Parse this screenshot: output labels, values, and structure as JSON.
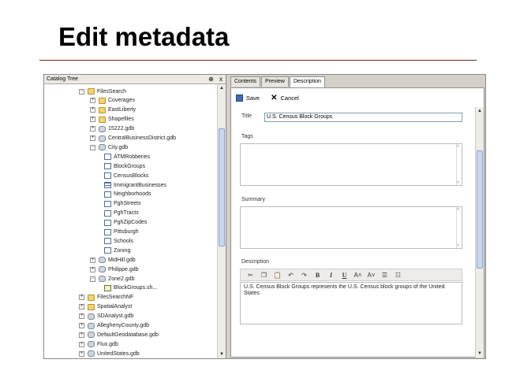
{
  "slide": {
    "title": "Edit metadata"
  },
  "catalog": {
    "header": "Catalog Tree",
    "controls": {
      "pin": "⊕",
      "close": "x"
    },
    "items": [
      {
        "label": "FilesSearch",
        "type": "folder",
        "expander": "−",
        "indent": 0
      },
      {
        "label": "Coverages",
        "type": "folder",
        "expander": "+",
        "indent": 1
      },
      {
        "label": "EastLiberty",
        "type": "folder",
        "expander": "+",
        "indent": 1
      },
      {
        "label": "Shapefiles",
        "type": "folder",
        "expander": "+",
        "indent": 1
      },
      {
        "label": "15222.gdb",
        "type": "db",
        "expander": "+",
        "indent": 1
      },
      {
        "label": "CentralBusinessDistrict.gdb",
        "type": "db",
        "expander": "+",
        "indent": 1
      },
      {
        "label": "City.gdb",
        "type": "db",
        "expander": "−",
        "indent": 1
      },
      {
        "label": "ATMRobberies",
        "type": "fc",
        "expander": "",
        "indent": 2
      },
      {
        "label": "BlockGroups",
        "type": "fc",
        "expander": "",
        "indent": 2
      },
      {
        "label": "CensusBlocks",
        "type": "fc",
        "expander": "",
        "indent": 2
      },
      {
        "label": "ImmigrantBusinesses",
        "type": "tbl",
        "expander": "",
        "indent": 2
      },
      {
        "label": "Neighborhoods",
        "type": "fc",
        "expander": "",
        "indent": 2
      },
      {
        "label": "PghStreets",
        "type": "fc",
        "expander": "",
        "indent": 2
      },
      {
        "label": "PghTracts",
        "type": "fc",
        "expander": "",
        "indent": 2
      },
      {
        "label": "PghZipCodes",
        "type": "fc",
        "expander": "",
        "indent": 2
      },
      {
        "label": "Pittsburgh",
        "type": "fc",
        "expander": "",
        "indent": 2
      },
      {
        "label": "Schools",
        "type": "fc",
        "expander": "",
        "indent": 2
      },
      {
        "label": "Zoning",
        "type": "fc",
        "expander": "",
        "indent": 2
      },
      {
        "label": "MidHill.gdb",
        "type": "db",
        "expander": "+",
        "indent": 1
      },
      {
        "label": "Philippe.gdb",
        "type": "db",
        "expander": "+",
        "indent": 1
      },
      {
        "label": "Zone2.gdb",
        "type": "db",
        "expander": "−",
        "indent": 1
      },
      {
        "label": "BlockGroups.sh...",
        "type": "fd",
        "expander": "",
        "indent": 2
      },
      {
        "label": "FilesSearchNF",
        "type": "folder",
        "expander": "+",
        "indent": 0
      },
      {
        "label": "SpatialAnalyst",
        "type": "folder",
        "expander": "+",
        "indent": 0
      },
      {
        "label": "SDAnalyst.gdb",
        "type": "db",
        "expander": "+",
        "indent": 0
      },
      {
        "label": "AlleghenyCounty.gdb",
        "type": "db",
        "expander": "+",
        "indent": 0
      },
      {
        "label": "DefaultGeodatabase.gdb",
        "type": "db",
        "expander": "+",
        "indent": 0
      },
      {
        "label": "Flux.gdb",
        "type": "db",
        "expander": "+",
        "indent": 0
      },
      {
        "label": "UnitedStates.gdb",
        "type": "db",
        "expander": "+",
        "indent": 0
      }
    ]
  },
  "tabs": [
    {
      "label": "Contents",
      "active": false
    },
    {
      "label": "Preview",
      "active": false
    },
    {
      "label": "Description",
      "active": true
    }
  ],
  "toolbar": {
    "save_label": "Save",
    "cancel_label": "Cancel"
  },
  "form": {
    "title_label": "Title",
    "title_value": "U.S. Census Block Groups",
    "tags_label": "Tags",
    "tags_value": "",
    "summary_label": "Summary",
    "summary_value": "",
    "description_label": "Description",
    "description_value": "U.S. Census Block Groups represents the U.S. Census block groups of the United States"
  },
  "rte_buttons": [
    {
      "name": "cut-icon",
      "glyph": "✂"
    },
    {
      "name": "copy-icon",
      "glyph": "❐"
    },
    {
      "name": "paste-icon",
      "glyph": "📋"
    },
    {
      "name": "undo-icon",
      "glyph": "↶"
    },
    {
      "name": "redo-icon",
      "glyph": "↷"
    },
    {
      "name": "bold-button",
      "glyph": "B"
    },
    {
      "name": "italic-button",
      "glyph": "I"
    },
    {
      "name": "underline-button",
      "glyph": "U"
    },
    {
      "name": "grow-font-button",
      "glyph": "A˄"
    },
    {
      "name": "shrink-font-button",
      "glyph": "A˅"
    },
    {
      "name": "bullet-list-button",
      "glyph": "☰"
    },
    {
      "name": "numbered-list-button",
      "glyph": "☷"
    }
  ]
}
